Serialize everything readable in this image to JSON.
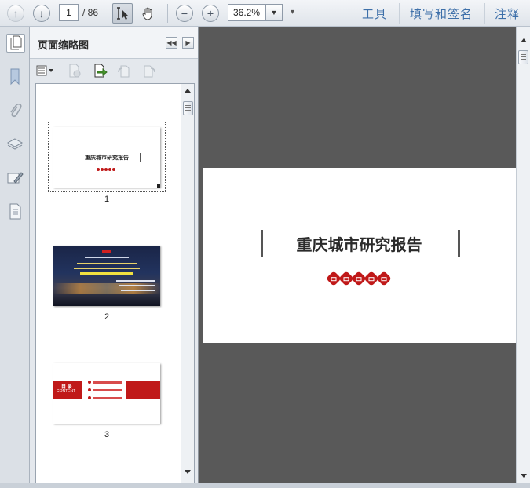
{
  "toolbar": {
    "page_current": "1",
    "page_total": "/ 86",
    "zoom": "36.2%",
    "links": [
      "工具",
      "填写和签名",
      "注释"
    ]
  },
  "panel": {
    "title": "页面缩略图"
  },
  "thumbnails": [
    {
      "label": "1",
      "title": "重庆城市研究报告"
    },
    {
      "label": "2"
    },
    {
      "label": "3",
      "heading": "目 录",
      "subheading": "CONTENT"
    }
  ],
  "document": {
    "title": "重庆城市研究报告"
  },
  "colors": {
    "accent_red": "#c01919",
    "link_blue": "#3d6fa9",
    "doc_background": "#595959"
  }
}
